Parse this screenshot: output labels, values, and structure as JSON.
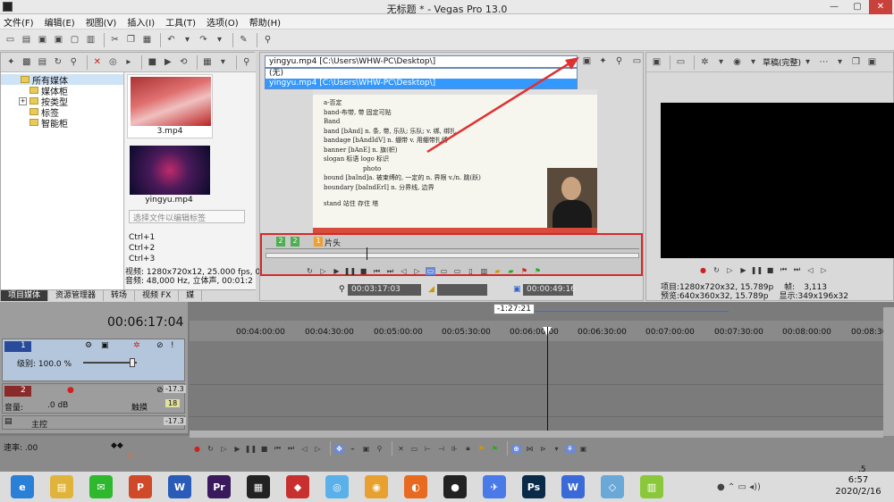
{
  "window": {
    "title": "无标题 * - Vegas Pro 13.0",
    "minimize": "—",
    "maximize": "▢",
    "close": "✕"
  },
  "menu": [
    "文件(F)",
    "编辑(E)",
    "视图(V)",
    "插入(I)",
    "工具(T)",
    "选项(O)",
    "帮助(H)"
  ],
  "explorer": {
    "tree": [
      "所有媒体",
      "媒体柜",
      "按类型",
      "标签",
      "智能柜"
    ],
    "clips": [
      {
        "name": "3.mp4"
      },
      {
        "name": "yingyu.mp4"
      }
    ],
    "hint": "选择文件以编辑标签",
    "shortcuts": [
      "Ctrl+1",
      "Ctrl+2",
      "Ctrl+3"
    ],
    "info_video": "视频: 1280x720x12, 25.000 fps, 0",
    "info_audio": "音频: 48,000 Hz, 立体声, 00:01:2",
    "tabs": [
      "项目媒体",
      "资源管理器",
      "转场",
      "视频 FX",
      "媒"
    ]
  },
  "trimmer": {
    "select_value": "yingyu.mp4     [C:\\Users\\WHW-PC\\Desktop\\]",
    "options": [
      "(无)",
      "yingyu.mp4     [C:\\Users\\WHW-PC\\Desktop\\]"
    ],
    "doc_lines": [
      "a-否定",
      "band-布带, 带 固定可贴",
      "Band",
      "band [bAnd]  n. 条, 带, 乐队; 乐队; v. 绑, 绑扎",
      "bandage [bAndIdV]  n. 绷带 v. 用绷带扎缚",
      "banner [bAnE]  n. 旗(帜)",
      "slogan 标语  logo 标识",
      "photo",
      "bound  [baInd]a. 被束缚的, 一定的  n. 界限 v./n. 跳(跃)",
      "boundary [baIndErI]  n. 分界线, 边界",
      "stand 站住 存住 塔"
    ],
    "markers": [
      {
        "label": "2"
      },
      {
        "label": "2"
      },
      {
        "label": "1",
        "text": "片头"
      }
    ],
    "time_in": "00:03:17:03",
    "time_len": "00:00:49:16"
  },
  "preview": {
    "quality": "草稿(完整)",
    "info": [
      {
        "label": "项目:",
        "value": "1280x720x32, 15.789p",
        "label2": "帧:",
        "value2": "3,113"
      },
      {
        "label": "预览:",
        "value": "640x360x32, 15.789p",
        "label2": "显示:",
        "value2": "349x196x32"
      }
    ]
  },
  "timeline": {
    "timecode": "00:06:17:04",
    "region_label": "-1:27:21",
    "ruler": [
      "00:04:00:00",
      "00:04:30:00",
      "00:05:00:00",
      "00:05:30:00",
      "00:06:00:00",
      "00:06:30:00",
      "00:07:00:00",
      "00:07:30:00",
      "00:08:00:00",
      "00:08:30"
    ],
    "video_track": {
      "number": "1",
      "level_label": "级别: 100.0 %"
    },
    "audio_track": {
      "number": "2",
      "volume_label": "音量:",
      "volume_value": ".0 dB",
      "pan_label": "触摸",
      "peak": "-17.3",
      "peak2": "18"
    },
    "master": {
      "label": "主控",
      "peak": "-17.3"
    },
    "rate_label": "速率: .00",
    "right_value": ".5"
  },
  "taskbar": {
    "apps": [
      {
        "name": "browser-360",
        "color": "#2a7fd6",
        "glyph": "e"
      },
      {
        "name": "file-explorer",
        "color": "#e0b43a",
        "glyph": "▤"
      },
      {
        "name": "wechat",
        "color": "#2eb82e",
        "glyph": "✉"
      },
      {
        "name": "powerpoint",
        "color": "#d04a2a",
        "glyph": "P"
      },
      {
        "name": "word",
        "color": "#2a5bb8",
        "glyph": "W"
      },
      {
        "name": "premiere",
        "color": "#3a1a5c",
        "glyph": "Pr"
      },
      {
        "name": "vegas",
        "color": "#222222",
        "glyph": "▦"
      },
      {
        "name": "wps",
        "color": "#c83030",
        "glyph": "◆"
      },
      {
        "name": "qq-browser",
        "color": "#5ab0e8",
        "glyph": "◎"
      },
      {
        "name": "chrome",
        "color": "#e8a030",
        "glyph": "◉"
      },
      {
        "name": "firefox",
        "color": "#e86a20",
        "glyph": "◐"
      },
      {
        "name": "qq",
        "color": "#222222",
        "glyph": "●"
      },
      {
        "name": "feishu",
        "color": "#4a7ae8",
        "glyph": "✈"
      },
      {
        "name": "photoshop",
        "color": "#0a2a4a",
        "glyph": "Ps"
      },
      {
        "name": "wps-office",
        "color": "#3a6ad8",
        "glyph": "W"
      },
      {
        "name": "notes",
        "color": "#6aa8d8",
        "glyph": "◇"
      },
      {
        "name": "notepad",
        "color": "#8ac83a",
        "glyph": "▥"
      }
    ],
    "time": "6:57",
    "date": "2020/2/16"
  },
  "colors": {
    "accent": "#3399ff",
    "highlight_border": "#d42a2a",
    "arrow": "#e03030"
  }
}
